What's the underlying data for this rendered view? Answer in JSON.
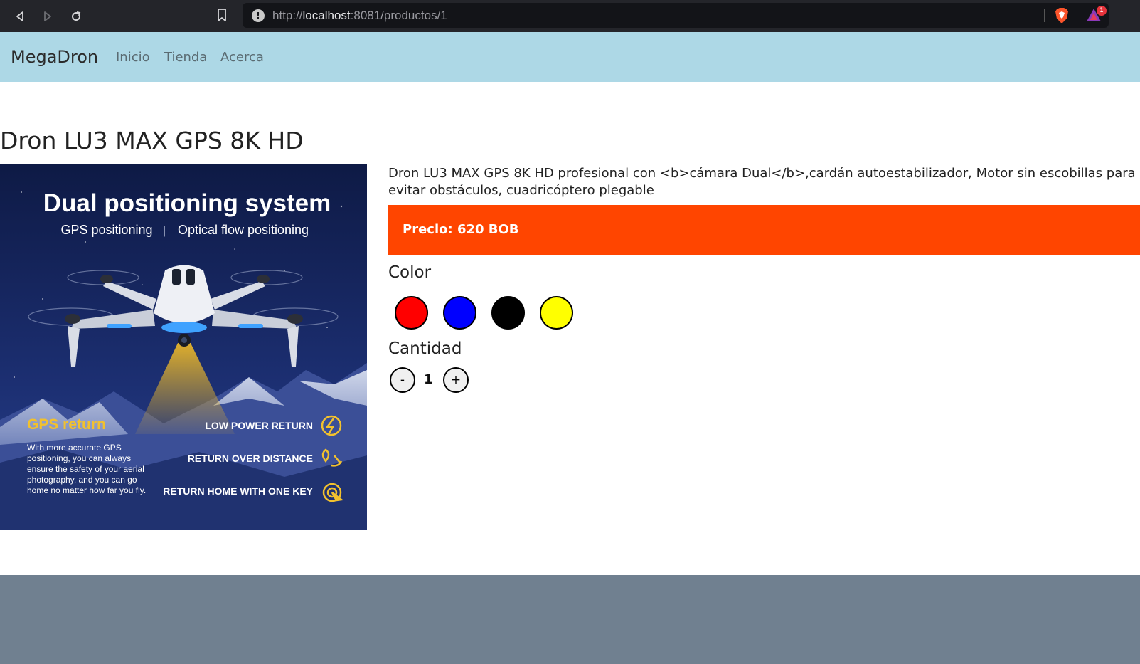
{
  "browser": {
    "url_prefix": "http://",
    "url_host": "localhost",
    "url_path": ":8081/productos/1",
    "info_glyph": "!",
    "notification_count": "1",
    "icons": [
      "back-icon",
      "forward-icon",
      "reload-icon",
      "bookmark-icon",
      "info-icon",
      "brave-shield-icon",
      "brave-rewards-icon"
    ]
  },
  "nav": {
    "brand": "MegaDron",
    "links": [
      "Inicio",
      "Tienda",
      "Acerca"
    ]
  },
  "product": {
    "title": "Dron LU3 MAX GPS 8K HD",
    "description": "Dron LU3 MAX GPS 8K HD profesional con <b>cámara Dual</b>,cardán autoestabilizador, Motor sin escobillas para evitar obstáculos, cuadricóptero plegable",
    "price_label": "Precio: 620 BOB",
    "color_heading": "Color",
    "colors": [
      "#ff0000",
      "#0000ff",
      "#000000",
      "#ffff00"
    ],
    "quantity_heading": "Cantidad",
    "quantity": "1",
    "minus_label": "-",
    "plus_label": "+"
  },
  "image_text": {
    "headline": "Dual positioning system",
    "sub_left": "GPS positioning",
    "sub_sep": "|",
    "sub_right": "Optical flow positioning",
    "gps_return": "GPS return",
    "paragraph": [
      "With more accurate GPS",
      "positioning, you can always",
      "ensure the safety of your aerial",
      "photography, and you can go",
      "home no matter how far you fly."
    ],
    "feature_1": "LOW POWER RETURN",
    "feature_2": "RETURN OVER DISTANCE",
    "feature_3": "RETURN HOME WITH ONE KEY"
  }
}
